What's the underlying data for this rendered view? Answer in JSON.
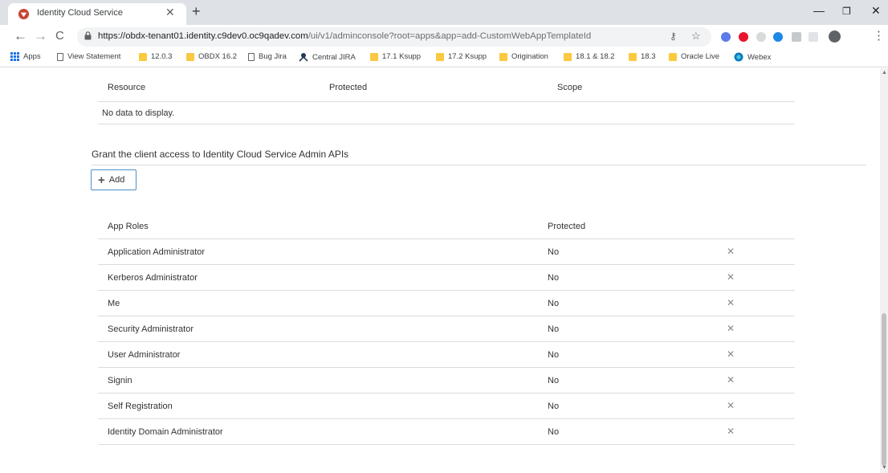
{
  "browser": {
    "tab_title": "Identity Cloud Service",
    "url_main": "https://obdx-tenant01.identity.c9dev0.oc9qadev.com",
    "url_rest": "/ui/v1/adminconsole?root=apps&app=add-CustomWebAppTemplateId"
  },
  "bookmarks": [
    {
      "label": "Apps",
      "icon": "apps-grid-icon"
    },
    {
      "label": "View Statement",
      "icon": "page-icon"
    },
    {
      "label": "12.0.3",
      "icon": "folder-icon"
    },
    {
      "label": "OBDX 16.2",
      "icon": "folder-icon"
    },
    {
      "label": "Bug Jira",
      "icon": "page-icon"
    },
    {
      "label": "Central JIRA",
      "icon": "jira-icon"
    },
    {
      "label": "17.1 Ksupp",
      "icon": "folder-icon"
    },
    {
      "label": "17.2 Ksupp",
      "icon": "folder-icon"
    },
    {
      "label": "Origination",
      "icon": "folder-icon"
    },
    {
      "label": "18.1 & 18.2",
      "icon": "folder-icon"
    },
    {
      "label": "18.3",
      "icon": "folder-icon"
    },
    {
      "label": "Oracle Live",
      "icon": "folder-icon"
    },
    {
      "label": "Webex",
      "icon": "webex-icon"
    }
  ],
  "resources_table": {
    "headers": {
      "resource": "Resource",
      "protected": "Protected",
      "scope": "Scope"
    },
    "empty_message": "No data to display."
  },
  "grant": {
    "title": "Grant the client access to Identity Cloud Service Admin APIs",
    "add_label": "Add"
  },
  "roles_table": {
    "headers": {
      "role": "App Roles",
      "protected": "Protected"
    },
    "rows": [
      {
        "role": "Application Administrator",
        "protected": "No"
      },
      {
        "role": "Kerberos Administrator",
        "protected": "No"
      },
      {
        "role": "Me",
        "protected": "No"
      },
      {
        "role": "Security Administrator",
        "protected": "No"
      },
      {
        "role": "User Administrator",
        "protected": "No"
      },
      {
        "role": "Signin",
        "protected": "No"
      },
      {
        "role": "Self Registration",
        "protected": "No"
      },
      {
        "role": "Identity Domain Administrator",
        "protected": "No"
      }
    ]
  },
  "colors": {
    "accent_border": "#4a90c8",
    "folder": "#f9c940"
  }
}
